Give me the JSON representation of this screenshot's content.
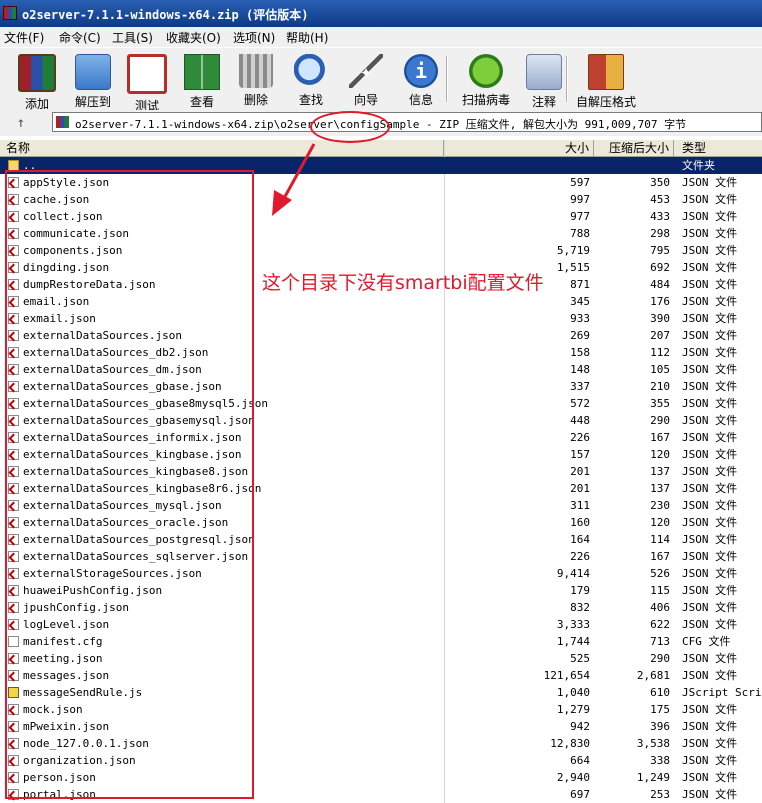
{
  "window": {
    "title": "o2server-7.1.1-windows-x64.zip (评估版本)"
  },
  "menu": [
    "文件(F)",
    "命令(C)",
    "工具(S)",
    "收藏夹(O)",
    "选项(N)",
    "帮助(H)"
  ],
  "toolbar": [
    {
      "label": "添加",
      "icon": "add-archive-icon"
    },
    {
      "label": "解压到",
      "icon": "extract-folder-icon"
    },
    {
      "label": "测试",
      "icon": "test-clipboard-icon"
    },
    {
      "label": "查看",
      "icon": "view-book-icon"
    },
    {
      "label": "删除",
      "icon": "trash-bin-icon"
    },
    {
      "label": "查找",
      "icon": "find-magnifier-icon"
    },
    {
      "label": "向导",
      "icon": "wizard-wand-icon"
    },
    {
      "label": "信息",
      "icon": "info-icon"
    },
    {
      "label": "扫描病毒",
      "icon": "virus-bug-icon"
    },
    {
      "label": "注释",
      "icon": "comment-icon"
    },
    {
      "label": "自解压格式",
      "icon": "sfx-box-icon"
    }
  ],
  "address": {
    "path": "o2server-7.1.1-windows-x64.zip\\o2server\\configSample - ZIP 压缩文件, 解包大小为 991,009,707 字节"
  },
  "columns": {
    "name": "名称",
    "size": "大小",
    "packed": "压缩后大小",
    "type": "类型"
  },
  "parent_row": {
    "name": "..",
    "type": "文件夹"
  },
  "files": [
    {
      "name": "appStyle.json",
      "size": "597",
      "packed": "350",
      "type": "JSON 文件",
      "icon": "json"
    },
    {
      "name": "cache.json",
      "size": "997",
      "packed": "453",
      "type": "JSON 文件",
      "icon": "json"
    },
    {
      "name": "collect.json",
      "size": "977",
      "packed": "433",
      "type": "JSON 文件",
      "icon": "json"
    },
    {
      "name": "communicate.json",
      "size": "788",
      "packed": "298",
      "type": "JSON 文件",
      "icon": "json"
    },
    {
      "name": "components.json",
      "size": "5,719",
      "packed": "795",
      "type": "JSON 文件",
      "icon": "json"
    },
    {
      "name": "dingding.json",
      "size": "1,515",
      "packed": "692",
      "type": "JSON 文件",
      "icon": "json"
    },
    {
      "name": "dumpRestoreData.json",
      "size": "871",
      "packed": "484",
      "type": "JSON 文件",
      "icon": "json"
    },
    {
      "name": "email.json",
      "size": "345",
      "packed": "176",
      "type": "JSON 文件",
      "icon": "json"
    },
    {
      "name": "exmail.json",
      "size": "933",
      "packed": "390",
      "type": "JSON 文件",
      "icon": "json"
    },
    {
      "name": "externalDataSources.json",
      "size": "269",
      "packed": "207",
      "type": "JSON 文件",
      "icon": "json"
    },
    {
      "name": "externalDataSources_db2.json",
      "size": "158",
      "packed": "112",
      "type": "JSON 文件",
      "icon": "json"
    },
    {
      "name": "externalDataSources_dm.json",
      "size": "148",
      "packed": "105",
      "type": "JSON 文件",
      "icon": "json"
    },
    {
      "name": "externalDataSources_gbase.json",
      "size": "337",
      "packed": "210",
      "type": "JSON 文件",
      "icon": "json"
    },
    {
      "name": "externalDataSources_gbase8mysql5.json",
      "size": "572",
      "packed": "355",
      "type": "JSON 文件",
      "icon": "json"
    },
    {
      "name": "externalDataSources_gbasemysql.json",
      "size": "448",
      "packed": "290",
      "type": "JSON 文件",
      "icon": "json"
    },
    {
      "name": "externalDataSources_informix.json",
      "size": "226",
      "packed": "167",
      "type": "JSON 文件",
      "icon": "json"
    },
    {
      "name": "externalDataSources_kingbase.json",
      "size": "157",
      "packed": "120",
      "type": "JSON 文件",
      "icon": "json"
    },
    {
      "name": "externalDataSources_kingbase8.json",
      "size": "201",
      "packed": "137",
      "type": "JSON 文件",
      "icon": "json"
    },
    {
      "name": "externalDataSources_kingbase8r6.json",
      "size": "201",
      "packed": "137",
      "type": "JSON 文件",
      "icon": "json"
    },
    {
      "name": "externalDataSources_mysql.json",
      "size": "311",
      "packed": "230",
      "type": "JSON 文件",
      "icon": "json"
    },
    {
      "name": "externalDataSources_oracle.json",
      "size": "160",
      "packed": "120",
      "type": "JSON 文件",
      "icon": "json"
    },
    {
      "name": "externalDataSources_postgresql.json",
      "size": "164",
      "packed": "114",
      "type": "JSON 文件",
      "icon": "json"
    },
    {
      "name": "externalDataSources_sqlserver.json",
      "size": "226",
      "packed": "167",
      "type": "JSON 文件",
      "icon": "json"
    },
    {
      "name": "externalStorageSources.json",
      "size": "9,414",
      "packed": "526",
      "type": "JSON 文件",
      "icon": "json"
    },
    {
      "name": "huaweiPushConfig.json",
      "size": "179",
      "packed": "115",
      "type": "JSON 文件",
      "icon": "json"
    },
    {
      "name": "jpushConfig.json",
      "size": "832",
      "packed": "406",
      "type": "JSON 文件",
      "icon": "json"
    },
    {
      "name": "logLevel.json",
      "size": "3,333",
      "packed": "622",
      "type": "JSON 文件",
      "icon": "json"
    },
    {
      "name": "manifest.cfg",
      "size": "1,744",
      "packed": "713",
      "type": "CFG 文件",
      "icon": "cfg"
    },
    {
      "name": "meeting.json",
      "size": "525",
      "packed": "290",
      "type": "JSON 文件",
      "icon": "json"
    },
    {
      "name": "messages.json",
      "size": "121,654",
      "packed": "2,681",
      "type": "JSON 文件",
      "icon": "json"
    },
    {
      "name": "messageSendRule.js",
      "size": "1,040",
      "packed": "610",
      "type": "JScript Script",
      "icon": "js"
    },
    {
      "name": "mock.json",
      "size": "1,279",
      "packed": "175",
      "type": "JSON 文件",
      "icon": "json"
    },
    {
      "name": "mPweixin.json",
      "size": "942",
      "packed": "396",
      "type": "JSON 文件",
      "icon": "json"
    },
    {
      "name": "node_127.0.0.1.json",
      "size": "12,830",
      "packed": "3,538",
      "type": "JSON 文件",
      "icon": "json"
    },
    {
      "name": "organization.json",
      "size": "664",
      "packed": "338",
      "type": "JSON 文件",
      "icon": "json"
    },
    {
      "name": "person.json",
      "size": "2,940",
      "packed": "1,249",
      "type": "JSON 文件",
      "icon": "json"
    },
    {
      "name": "portal.json",
      "size": "697",
      "packed": "253",
      "type": "JSON 文件",
      "icon": "json"
    }
  ],
  "annotation": {
    "text": "这个目录下没有smartbi配置文件",
    "color": "#e1192d"
  },
  "colors": {
    "selection": "#0a246a",
    "titlebar": "#0e3a86",
    "highlight": "#e1192d"
  }
}
